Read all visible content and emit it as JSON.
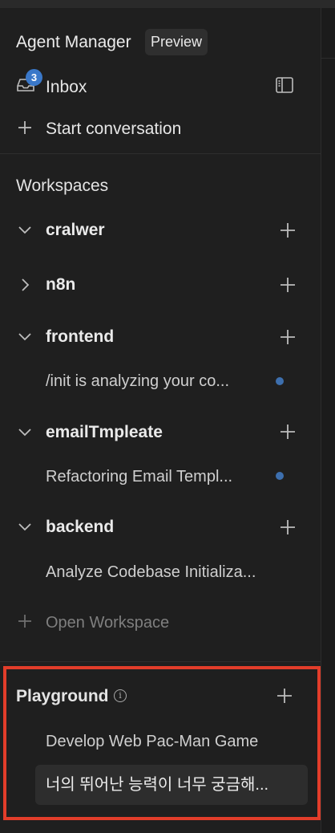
{
  "header": {
    "title": "Agent Manager",
    "badge": "Preview"
  },
  "inbox": {
    "label": "Inbox",
    "count": "3",
    "icon": "inbox-icon"
  },
  "start": {
    "label": "Start conversation",
    "icon": "plus-icon"
  },
  "workspaces": {
    "title": "Workspaces",
    "items": [
      {
        "name": "cralwer",
        "expanded": true,
        "conversations": []
      },
      {
        "name": "n8n",
        "expanded": false,
        "conversations": []
      },
      {
        "name": "frontend",
        "expanded": true,
        "conversations": [
          {
            "title": "/init is analyzing your co...",
            "unread": true
          }
        ]
      },
      {
        "name": "emailTmpleate",
        "expanded": true,
        "conversations": [
          {
            "title": "Refactoring Email Templ...",
            "unread": true
          }
        ]
      },
      {
        "name": "backend",
        "expanded": true,
        "conversations": [
          {
            "title": "Analyze Codebase Initializa...",
            "unread": false
          }
        ]
      }
    ],
    "open_label": "Open Workspace"
  },
  "playground": {
    "title": "Playground",
    "conversations": [
      {
        "title": "Develop Web Pac-Man Game",
        "selected": false
      },
      {
        "title": "너의 뛰어난 능력이 너무 궁금해...",
        "selected": true
      }
    ]
  },
  "colors": {
    "accent_badge": "#3a78c9",
    "unread_dot": "#3d6fae",
    "highlight_border": "#e23d2a",
    "background": "#1f1f1f"
  }
}
